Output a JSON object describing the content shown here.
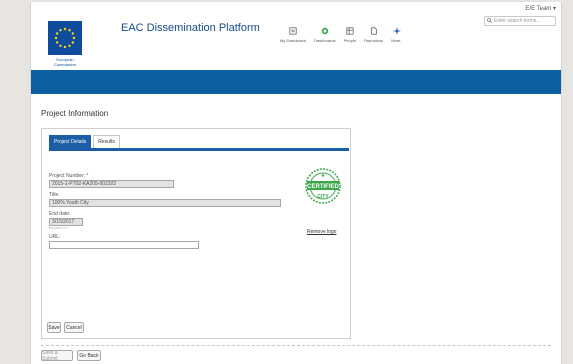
{
  "header": {
    "user_menu": "E/E Team ▾",
    "search_placeholder": "Enter search terms...",
    "logo_text_line1": "European",
    "logo_text_line2": "Commission",
    "app_title": "EAC Dissemination Platform",
    "nav": [
      {
        "label": "My Dashboard",
        "icon": "dashboard-icon"
      },
      {
        "label": "Dashboards",
        "icon": "dashboards-icon"
      },
      {
        "label": "People",
        "icon": "people-icon"
      },
      {
        "label": "Repository",
        "icon": "repository-icon"
      },
      {
        "label": "More..",
        "icon": "more-icon"
      }
    ]
  },
  "page_heading": "Project Information",
  "tabs": [
    {
      "label": "Project Details",
      "active": true
    },
    {
      "label": "Results",
      "active": false
    }
  ],
  "form": {
    "project_number_label": "Project Number: *",
    "project_number_value": "2015-1-PT02-KA205-002322",
    "title_label": "Title:",
    "title_value": "100% Youth City",
    "end_date_label": "End date:",
    "end_date_value": "3/15/2017",
    "end_date_hint": "DD/MM/YYYY",
    "url_label": "URL:",
    "url_value": ""
  },
  "stamp": {
    "top_text": "CERTIFIED",
    "bottom_text": "CITY"
  },
  "remove_logo": "Remove logo",
  "buttons": {
    "save": "Save",
    "cancel": "Cancel",
    "save_submit": "Save & Submit",
    "go_back": "Go Back"
  },
  "colors": {
    "brand_blue": "#0e60a0",
    "tab_active": "#1c5ea6",
    "stamp_green": "#3aa84a"
  }
}
